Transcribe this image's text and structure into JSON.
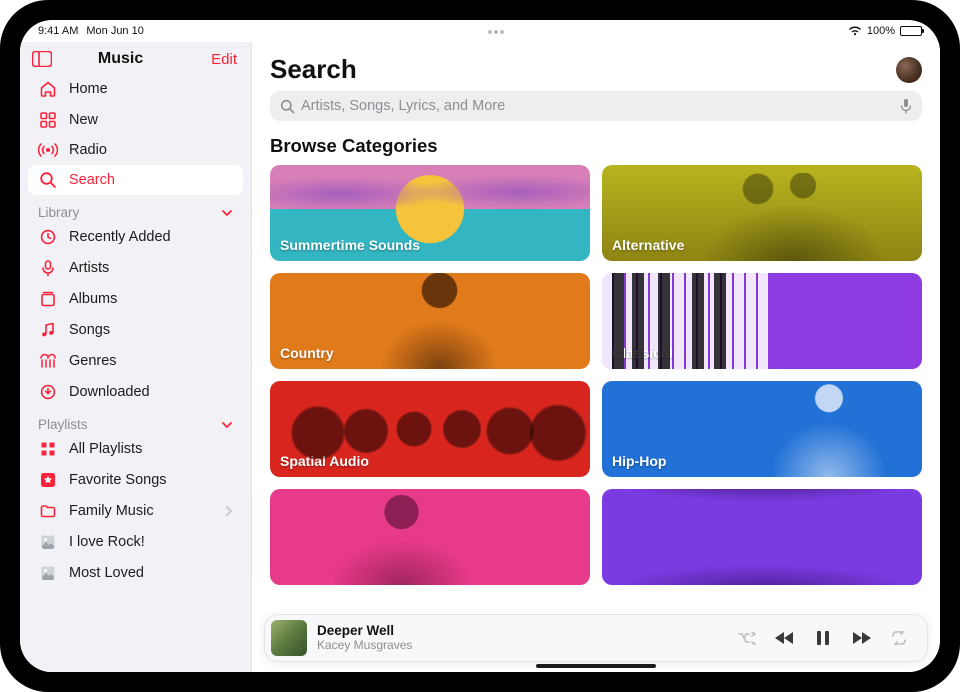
{
  "statusbar": {
    "time": "9:41 AM",
    "date": "Mon Jun 10",
    "battery": "100%"
  },
  "sidebar": {
    "layout_icon": "sidebar-layout-icon",
    "title": "Music",
    "edit": "Edit",
    "primary": [
      {
        "key": "home",
        "label": "Home",
        "icon": "home-icon"
      },
      {
        "key": "new",
        "label": "New",
        "icon": "grid-icon"
      },
      {
        "key": "radio",
        "label": "Radio",
        "icon": "radio-icon"
      },
      {
        "key": "search",
        "label": "Search",
        "icon": "search-icon",
        "active": true
      }
    ],
    "library_header": "Library",
    "library": [
      {
        "key": "recent",
        "label": "Recently Added",
        "icon": "clock-icon"
      },
      {
        "key": "artists",
        "label": "Artists",
        "icon": "mic-icon"
      },
      {
        "key": "albums",
        "label": "Albums",
        "icon": "album-icon"
      },
      {
        "key": "songs",
        "label": "Songs",
        "icon": "note-icon"
      },
      {
        "key": "genres",
        "label": "Genres",
        "icon": "guitar-icon"
      },
      {
        "key": "downloaded",
        "label": "Downloaded",
        "icon": "download-icon"
      }
    ],
    "playlists_header": "Playlists",
    "playlists": [
      {
        "key": "all",
        "label": "All Playlists",
        "icon": "playlists-icon"
      },
      {
        "key": "fav",
        "label": "Favorite Songs",
        "icon": "star-icon"
      },
      {
        "key": "family",
        "label": "Family Music",
        "icon": "folder-icon",
        "chevron": true
      },
      {
        "key": "rock",
        "label": "I love Rock!",
        "icon": "art-icon"
      },
      {
        "key": "most",
        "label": "Most Loved",
        "icon": "art-icon"
      }
    ]
  },
  "page": {
    "title": "Search",
    "search_placeholder": "Artists, Songs, Lyrics, and More",
    "section_title": "Browse Categories",
    "categories": [
      {
        "label": "Summertime Sounds",
        "bg": "summertime"
      },
      {
        "label": "Alternative",
        "bg": "alternative"
      },
      {
        "label": "Country",
        "bg": "country"
      },
      {
        "label": "Classical",
        "bg": "classical"
      },
      {
        "label": "Spatial Audio",
        "bg": "spatial"
      },
      {
        "label": "Hip-Hop",
        "bg": "hiphop"
      },
      {
        "label": "",
        "bg": "pink"
      },
      {
        "label": "",
        "bg": "purple"
      }
    ]
  },
  "now_playing": {
    "title": "Deeper Well",
    "artist": "Kacey Musgraves",
    "controls": {
      "shuffle": "shuffle-icon",
      "prev": "previous-track-icon",
      "pause": "pause-icon",
      "next": "next-track-icon",
      "repeat": "repeat-icon"
    }
  }
}
